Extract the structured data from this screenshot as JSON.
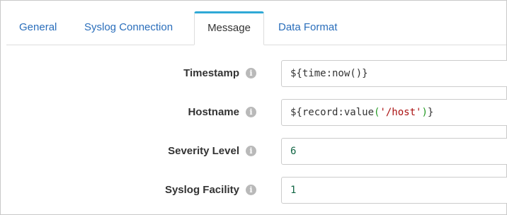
{
  "tabs": [
    {
      "label": "General",
      "active": false
    },
    {
      "label": "Syslog Connection",
      "active": false
    },
    {
      "label": "Message",
      "active": true
    },
    {
      "label": "Data Format",
      "active": false
    }
  ],
  "form": {
    "timestamp": {
      "label": "Timestamp",
      "value": "${time:now()}"
    },
    "hostname": {
      "label": "Hostname",
      "value": "${record:value('/host')}",
      "value_parts": {
        "prefix": "${record:value",
        "open": "(",
        "string": "'/host'",
        "close": ")",
        "suffix": "}"
      }
    },
    "severity_level": {
      "label": "Severity Level",
      "value": "6"
    },
    "syslog_facility": {
      "label": "Syslog Facility",
      "value": "1"
    }
  },
  "icons": {
    "info": "info-icon"
  },
  "colors": {
    "active_tab_accent": "#2fa9d6",
    "link": "#2a6ebb",
    "string_literal": "#aa1111",
    "number_literal": "#116644"
  }
}
